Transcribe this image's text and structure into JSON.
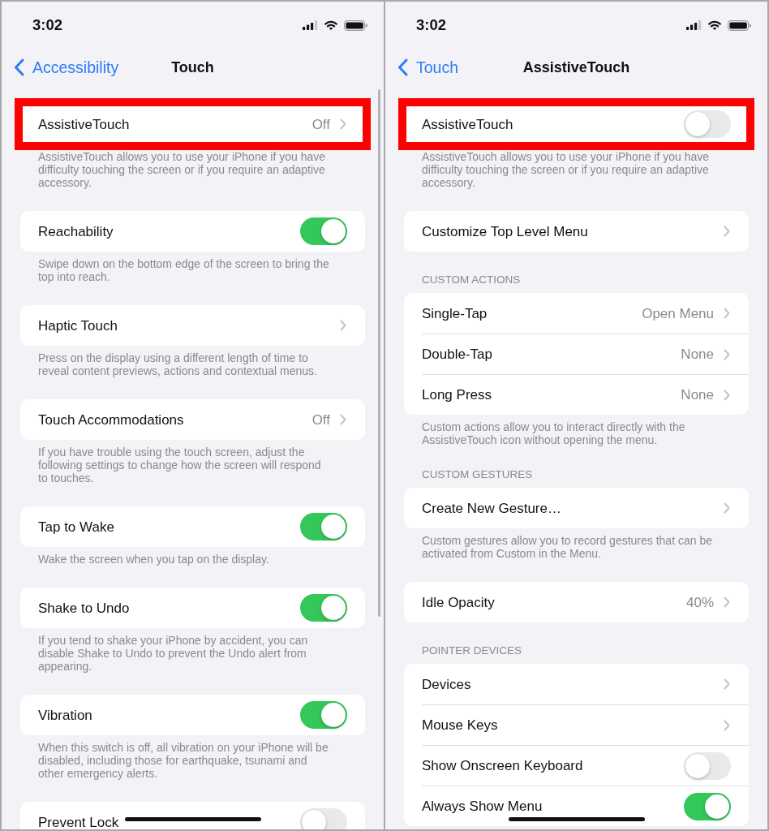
{
  "screens": [
    {
      "status_bar": {
        "time": "3:02"
      },
      "nav": {
        "back": "Accessibility",
        "title": "Touch"
      },
      "scroll_indicator": true,
      "sections": [
        {
          "highlighted": true,
          "rows": [
            {
              "kind": "link",
              "label": "AssistiveTouch",
              "value": "Off"
            }
          ],
          "footer": "AssistiveTouch allows you to use your iPhone if you have difficulty touching the screen or if you require an adaptive accessory."
        },
        {
          "highlighted": false,
          "rows": [
            {
              "kind": "toggle",
              "label": "Reachability",
              "on": true
            }
          ],
          "footer": "Swipe down on the bottom edge of the screen to bring the top into reach."
        },
        {
          "highlighted": false,
          "rows": [
            {
              "kind": "link",
              "label": "Haptic Touch"
            }
          ],
          "footer": "Press on the display using a different length of time to reveal content previews, actions and contextual menus."
        },
        {
          "highlighted": false,
          "rows": [
            {
              "kind": "link",
              "label": "Touch Accommodations",
              "value": "Off"
            }
          ],
          "footer": "If you have trouble using the touch screen, adjust the following settings to change how the screen will respond to touches."
        },
        {
          "highlighted": false,
          "rows": [
            {
              "kind": "toggle",
              "label": "Tap to Wake",
              "on": true
            }
          ],
          "footer": "Wake the screen when you tap on the display."
        },
        {
          "highlighted": false,
          "rows": [
            {
              "kind": "toggle",
              "label": "Shake to Undo",
              "on": true
            }
          ],
          "footer": "If you tend to shake your iPhone by accident, you can disable Shake to Undo to prevent the Undo alert from appearing."
        },
        {
          "highlighted": false,
          "rows": [
            {
              "kind": "toggle",
              "label": "Vibration",
              "on": true
            }
          ],
          "footer": "When this switch is off, all vibration on your iPhone will be disabled, including those for earthquake, tsunami and other emergency alerts."
        },
        {
          "highlighted": false,
          "rows": [
            {
              "kind": "toggle",
              "label": "Prevent Lock",
              "on": false
            }
          ]
        }
      ]
    },
    {
      "status_bar": {
        "time": "3:02"
      },
      "nav": {
        "back": "Touch",
        "title": "AssistiveTouch"
      },
      "scroll_indicator": false,
      "sections": [
        {
          "highlighted": true,
          "rows": [
            {
              "kind": "toggle",
              "label": "AssistiveTouch",
              "on": false
            }
          ],
          "footer": "AssistiveTouch allows you to use your iPhone if you have difficulty touching the screen or if you require an adaptive accessory."
        },
        {
          "highlighted": false,
          "rows": [
            {
              "kind": "link",
              "label": "Customize Top Level Menu"
            }
          ]
        },
        {
          "highlighted": false,
          "header": "CUSTOM ACTIONS",
          "rows": [
            {
              "kind": "link",
              "label": "Single-Tap",
              "value": "Open Menu"
            },
            {
              "kind": "link",
              "label": "Double-Tap",
              "value": "None"
            },
            {
              "kind": "link",
              "label": "Long Press",
              "value": "None"
            }
          ],
          "footer": "Custom actions allow you to interact directly with the AssistiveTouch icon without opening the menu."
        },
        {
          "highlighted": false,
          "header": "CUSTOM GESTURES",
          "rows": [
            {
              "kind": "link",
              "label": "Create New Gesture…"
            }
          ],
          "footer": "Custom gestures allow you to record gestures that can be activated from Custom in the Menu."
        },
        {
          "highlighted": false,
          "rows": [
            {
              "kind": "link",
              "label": "Idle Opacity",
              "value": "40%"
            }
          ]
        },
        {
          "highlighted": false,
          "header": "POINTER DEVICES",
          "rows": [
            {
              "kind": "link",
              "label": "Devices"
            },
            {
              "kind": "link",
              "label": "Mouse Keys"
            },
            {
              "kind": "toggle",
              "label": "Show Onscreen Keyboard",
              "on": false
            },
            {
              "kind": "toggle",
              "label": "Always Show Menu",
              "on": true
            }
          ]
        }
      ]
    }
  ]
}
